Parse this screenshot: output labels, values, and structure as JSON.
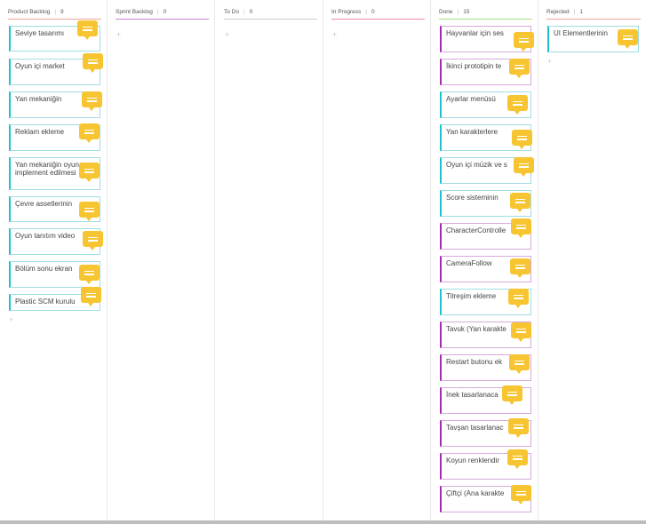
{
  "colors": {
    "cyan_card": "#1fc1cf",
    "purple_card": "#a22bb0",
    "note_yellow": "#f7c531",
    "head_product": "#f3a39a",
    "head_sprint": "#c97fd4",
    "head_todo": "#cccccc",
    "head_progress": "#f08aa8",
    "head_done": "#a7de78",
    "head_rejected": "#f3a39a"
  },
  "add_symbol": "+",
  "columns": [
    {
      "title": "Product Backlog",
      "count": "9",
      "cards": [
        {
          "text": "Seviye tasarımı"
        },
        {
          "text": "Oyun içi market"
        },
        {
          "text": "Yan mekaniğin"
        },
        {
          "text": "Reklam ekleme"
        },
        {
          "text": "Yan mekaniğin oyuna implement edilmesi"
        },
        {
          "text": "Çevre assetlerinin"
        },
        {
          "text": "Oyun tanıtım video"
        },
        {
          "text": "Bölüm sonu ekran"
        },
        {
          "text": "Plastic SCM kurulu"
        }
      ]
    },
    {
      "title": "Sprint Backlog",
      "count": "0",
      "cards": []
    },
    {
      "title": "To Do",
      "count": "0",
      "cards": []
    },
    {
      "title": "In Progress",
      "count": "0",
      "cards": []
    },
    {
      "title": "Done",
      "count": "15",
      "cards": [
        {
          "text": "Hayvanlar için ses"
        },
        {
          "text": "İkinci prototipin te"
        },
        {
          "text": "Ayarlar menüsü"
        },
        {
          "text": "Yan karakterlere"
        },
        {
          "text": "Oyun içi müzik ve s"
        },
        {
          "text": "Score sisteminin"
        },
        {
          "text": "CharacterControlle"
        },
        {
          "text": "CameraFollow"
        },
        {
          "text": "Titreşim ekleme"
        },
        {
          "text": "Tavuk (Yan karakte"
        },
        {
          "text": "Restart butonu ek"
        },
        {
          "text": "İnek tasarlanaca"
        },
        {
          "text": "Tavşan tasarlanac"
        },
        {
          "text": "Koyun renklendir"
        },
        {
          "text": "Çiftçi (Ana karakte"
        }
      ]
    },
    {
      "title": "Rejected",
      "count": "1",
      "cards": [
        {
          "text": "UI Elementlerinin"
        }
      ]
    }
  ]
}
